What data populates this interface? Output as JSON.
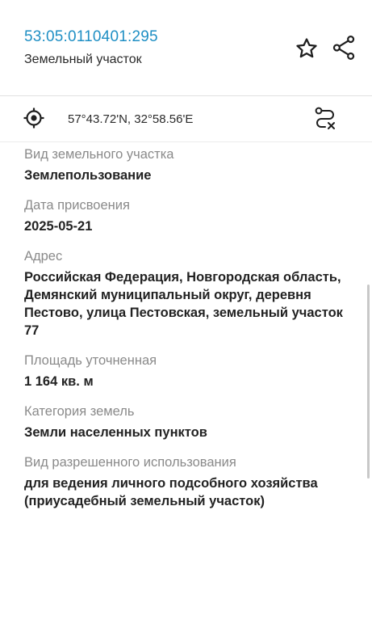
{
  "header": {
    "cadastral_number": "53:05:0110401:295",
    "object_type": "Земельный участок"
  },
  "icons": {
    "favorite": "star-outline-icon",
    "share": "share-icon",
    "location": "crosshair-target-icon",
    "route": "route-off-icon"
  },
  "coordinates": {
    "text": "57°43.72'N, 32°58.56'E"
  },
  "fields": [
    {
      "label": "Вид земельного участка",
      "value": "Землепользование"
    },
    {
      "label": "Дата присвоения",
      "value": "2025-05-21"
    },
    {
      "label": "Адрес",
      "value": "Российская Федерация, Новгородская область, Демянский муниципальный округ, деревня Пестово, улица Пестовская, земельный участок 77"
    },
    {
      "label": "Площадь уточненная",
      "value": "1 164 кв. м"
    },
    {
      "label": "Категория земель",
      "value": "Земли населенных пунктов"
    },
    {
      "label": "Вид разрешенного использования",
      "value": "для ведения личного подсобного хозяйства (приусадебный земельный участок)"
    }
  ],
  "colors": {
    "link": "#1f8fc4",
    "label": "#8a8a8a",
    "value": "#222222"
  }
}
